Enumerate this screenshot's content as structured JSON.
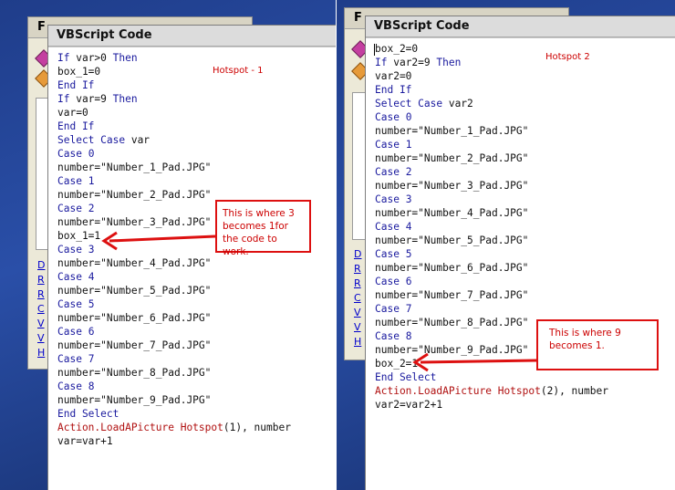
{
  "left": {
    "background_window": {
      "title_initial": "F",
      "links": [
        "D",
        "R",
        "R",
        "C",
        "V",
        "V",
        "H"
      ]
    },
    "code_window": {
      "title": "VBScript Code",
      "hotspot_label": "Hotspot - 1",
      "lines": [
        {
          "kw": "If ",
          "tx": "var>0 ",
          "kw2": "Then"
        },
        {
          "tx": "box_1=0"
        },
        {
          "kw": "End If"
        },
        {
          "kw": "If ",
          "tx": "var=9 ",
          "kw2": "Then"
        },
        {
          "tx": "var=0"
        },
        {
          "kw": "End If"
        },
        {
          "kw": "Select Case ",
          "tx": "var"
        },
        {
          "kw": "Case ",
          "kw2": "0"
        },
        {
          "tx": "number=\"Number_1_Pad.JPG\""
        },
        {
          "kw": "Case ",
          "kw2": "1"
        },
        {
          "tx": "number=\"Number_2_Pad.JPG\""
        },
        {
          "kw": "Case ",
          "kw2": "2"
        },
        {
          "tx": "number=\"Number_3_Pad.JPG\""
        },
        {
          "tx": "box_1=1"
        },
        {
          "kw": "Case ",
          "kw2": "3"
        },
        {
          "tx": "number=\"Number_4_Pad.JPG\""
        },
        {
          "kw": "Case ",
          "kw2": "4"
        },
        {
          "tx": "number=\"Number_5_Pad.JPG\""
        },
        {
          "kw": "Case ",
          "kw2": "5"
        },
        {
          "tx": "number=\"Number_6_Pad.JPG\""
        },
        {
          "kw": "Case ",
          "kw2": "6"
        },
        {
          "tx": "number=\"Number_7_Pad.JPG\""
        },
        {
          "kw": "Case ",
          "kw2": "7"
        },
        {
          "tx": "number=\"Number_8_Pad.JPG\""
        },
        {
          "kw": "Case ",
          "kw2": "8"
        },
        {
          "tx": "number=\"Number_9_Pad.JPG\""
        },
        {
          "kw": "End Select"
        },
        {
          "act": "Action.LoadAPicture Hotspot",
          "tx": "(1), number"
        },
        {
          "tx": "var=var+1"
        }
      ]
    },
    "annotation": "This is where 3 becomes 1for the code to work."
  },
  "right": {
    "background_window": {
      "title_initial": "F",
      "links": [
        "D",
        "R",
        "R",
        "C",
        "V",
        "V",
        "H"
      ]
    },
    "code_window": {
      "title": "VBScript Code",
      "hotspot_label": "Hotspot 2",
      "lines": [
        {
          "tx": "box_2=0"
        },
        {
          "kw": "If ",
          "tx": "var2=9 ",
          "kw2": "Then"
        },
        {
          "tx": "var2=0"
        },
        {
          "kw": "End If"
        },
        {
          "kw": "Select Case ",
          "tx": "var2"
        },
        {
          "kw": "Case ",
          "kw2": "0"
        },
        {
          "tx": "number=\"Number_1_Pad.JPG\""
        },
        {
          "kw": "Case ",
          "kw2": "1"
        },
        {
          "tx": "number=\"Number_2_Pad.JPG\""
        },
        {
          "kw": "Case ",
          "kw2": "2"
        },
        {
          "tx": "number=\"Number_3_Pad.JPG\""
        },
        {
          "kw": "Case ",
          "kw2": "3"
        },
        {
          "tx": "number=\"Number_4_Pad.JPG\""
        },
        {
          "kw": "Case ",
          "kw2": "4"
        },
        {
          "tx": "number=\"Number_5_Pad.JPG\""
        },
        {
          "kw": "Case ",
          "kw2": "5"
        },
        {
          "tx": "number=\"Number_6_Pad.JPG\""
        },
        {
          "kw": "Case ",
          "kw2": "6"
        },
        {
          "tx": "number=\"Number_7_Pad.JPG\""
        },
        {
          "kw": "Case ",
          "kw2": "7"
        },
        {
          "tx": "number=\"Number_8_Pad.JPG\""
        },
        {
          "kw": "Case ",
          "kw2": "8"
        },
        {
          "tx": "number=\"Number_9_Pad.JPG\""
        },
        {
          "tx": "box_2=1"
        },
        {
          "kw": "End Select"
        },
        {
          "act": "Action.LoadAPicture Hotspot",
          "tx": "(2), number"
        },
        {
          "tx": "var2=var2+1"
        }
      ]
    },
    "annotation": "This is where 9 becomes 1."
  },
  "colors": {
    "keyword": "#1a1a9e",
    "action": "#b01010",
    "annotation": "#cc0000",
    "desktop": "#2a4fa8"
  }
}
